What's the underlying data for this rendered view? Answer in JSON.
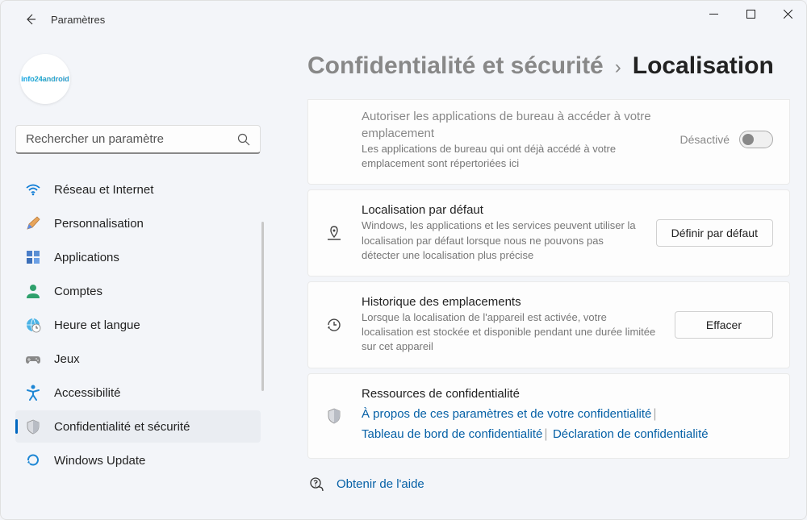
{
  "window": {
    "title": "Paramètres"
  },
  "avatar": {
    "text": "info24android"
  },
  "search": {
    "placeholder": "Rechercher un paramètre"
  },
  "sidebar": {
    "items": [
      {
        "label": "Réseau et Internet"
      },
      {
        "label": "Personnalisation"
      },
      {
        "label": "Applications"
      },
      {
        "label": "Comptes"
      },
      {
        "label": "Heure et langue"
      },
      {
        "label": "Jeux"
      },
      {
        "label": "Accessibilité"
      },
      {
        "label": "Confidentialité et sécurité"
      },
      {
        "label": "Windows Update"
      }
    ]
  },
  "breadcrumb": {
    "parent": "Confidentialité et sécurité",
    "sep": "›",
    "current": "Localisation"
  },
  "cards": {
    "desktop_apps": {
      "title": "Autoriser les applications de bureau à accéder à votre emplacement",
      "desc": "Les applications de bureau qui ont déjà accédé à votre emplacement sont répertoriées ici",
      "toggle_label": "Désactivé"
    },
    "default_loc": {
      "title": "Localisation par défaut",
      "desc": "Windows, les applications et les services peuvent utiliser la localisation par défaut lorsque nous ne pouvons pas détecter une localisation plus précise",
      "button": "Définir par défaut"
    },
    "history": {
      "title": "Historique des emplacements",
      "desc": "Lorsque la localisation de l'appareil est activée, votre localisation est stockée et disponible pendant une durée limitée sur cet appareil",
      "button": "Effacer"
    },
    "resources": {
      "title": "Ressources de confidentialité",
      "link1": "À propos de ces paramètres et de votre confidentialité",
      "link2": "Tableau de bord de confidentialité",
      "link3": "Déclaration de confidentialité"
    }
  },
  "help": {
    "label": "Obtenir de l'aide"
  }
}
